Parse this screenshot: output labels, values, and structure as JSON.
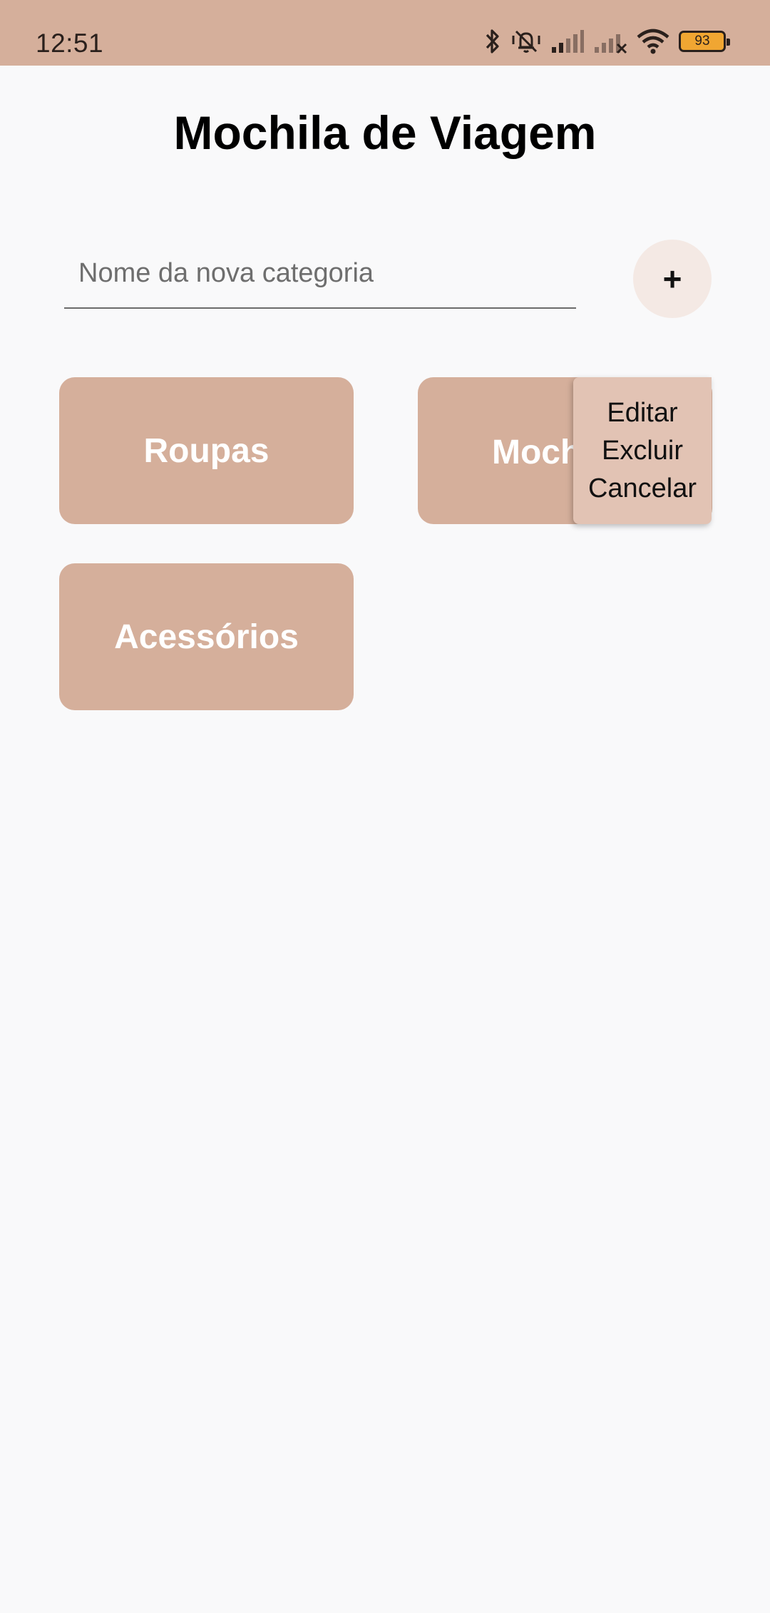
{
  "status_bar": {
    "time": "12:51",
    "battery_level": "93",
    "icons": [
      "bluetooth-icon",
      "silent-mode-icon",
      "signal-icon",
      "signal-off-icon",
      "wifi-icon",
      "battery-icon"
    ],
    "background_color": "#d5af9b"
  },
  "page": {
    "title": "Mochila de Viagem"
  },
  "new_category": {
    "placeholder": "Nome da nova categoria",
    "value": "",
    "add_button_label": "+"
  },
  "categories": [
    {
      "label": "Roupas"
    },
    {
      "label": "Mochila"
    },
    {
      "label": "Acessórios"
    }
  ],
  "context_menu": {
    "items": [
      {
        "label": "Editar"
      },
      {
        "label": "Excluir"
      },
      {
        "label": "Cancelar"
      }
    ]
  },
  "colors": {
    "accent": "#d5af9b",
    "menu_background": "#e2c3b4",
    "add_button_background": "#f4e9e4",
    "page_background": "#f9f9fa"
  }
}
